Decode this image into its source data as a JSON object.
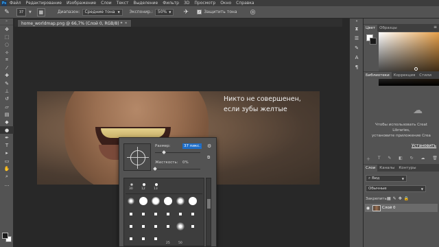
{
  "menubar": {
    "logo": "Ps",
    "items": [
      "Файл",
      "Редактирование",
      "Изображение",
      "Слои",
      "Текст",
      "Выделение",
      "Фильтр",
      "3D",
      "Просмотр",
      "Окно",
      "Справка"
    ]
  },
  "options": {
    "brush_size": "37",
    "range_label": "Диапазон:",
    "range_value": "Средние тона",
    "exposure_label": "Экспонир.:",
    "exposure_value": "50%",
    "protect_tones_label": "Защитить тона"
  },
  "document": {
    "tab_title": "home_worldmap.png @ 66,7% (Слой 0, RGB/8) *",
    "headline_line1": "Никто не совершенен,",
    "headline_line2": "если зубы желтые"
  },
  "brush_picker": {
    "size_label": "Размер:",
    "size_value": "37 пикс.",
    "hardness_label": "Жесткость:",
    "hardness_value": "0%",
    "size_slider": 0.2,
    "hardness_slider": 0.0,
    "preset_numbers": [
      "30",
      "12",
      "13",
      "25",
      "50"
    ]
  },
  "panels": {
    "color_tab": "Цвет",
    "swatches_tab": "Образцы",
    "libraries_tab": "Библиотеки",
    "corrections_tab": "Коррекция",
    "styles_tab": "Стили",
    "lib_text1": "Чтобы использовать Creat",
    "lib_text2": "Libraries,",
    "lib_text3": "установите приложение Crea",
    "lib_install": "Установить",
    "layers_tab": "Слои",
    "channels_tab": "Каналы",
    "paths_tab": "Контуры",
    "kind_filter": "Вид",
    "blend_mode": "Обычные",
    "lock_label": "Закрепить:",
    "layer_name": "Слой 0"
  }
}
